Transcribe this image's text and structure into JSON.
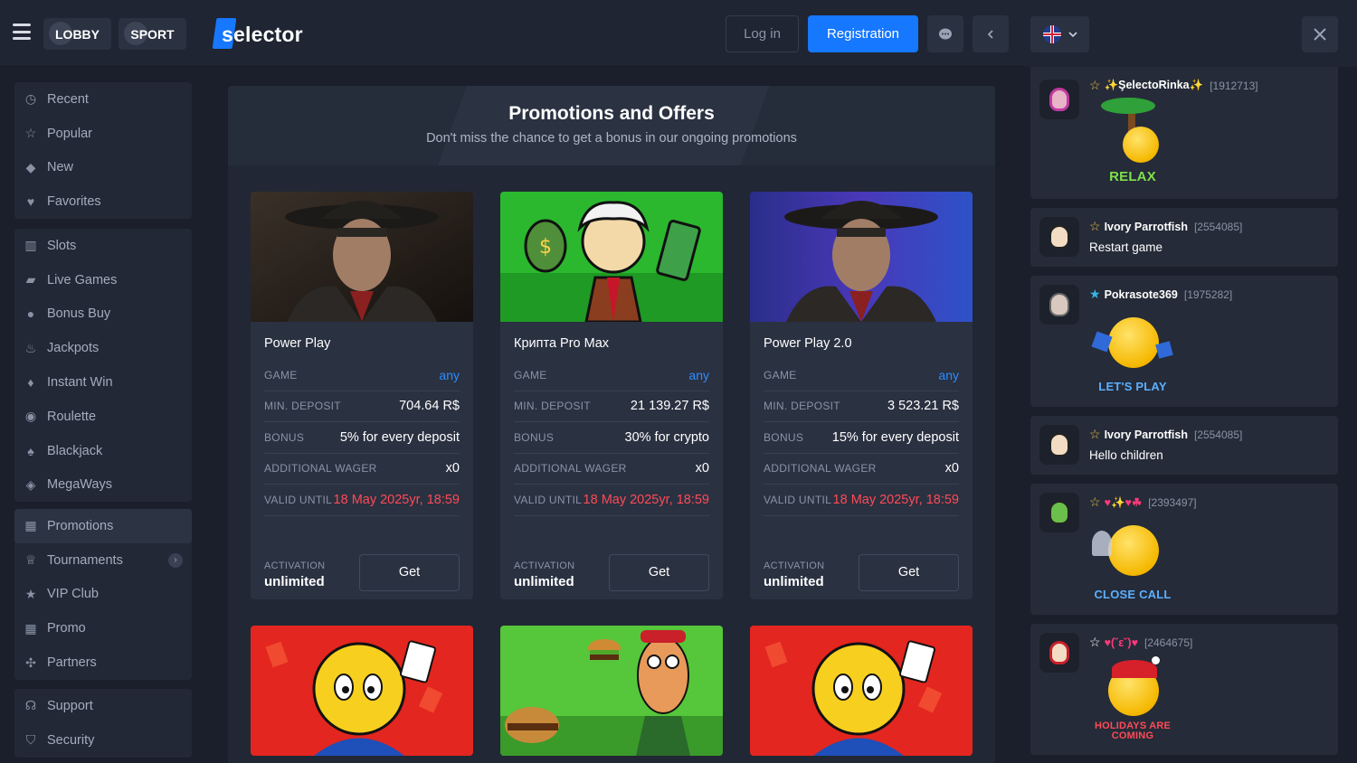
{
  "header": {
    "tabs": [
      {
        "label": "LOBBY"
      },
      {
        "label": "SPORT"
      }
    ],
    "logo": "selector",
    "login_label": "Log in",
    "register_label": "Registration"
  },
  "sidebar": {
    "group1": [
      {
        "label": "Recent",
        "icon": "clock-icon"
      },
      {
        "label": "Popular",
        "icon": "star-icon"
      },
      {
        "label": "New",
        "icon": "diamond-icon"
      },
      {
        "label": "Favorites",
        "icon": "heart-icon"
      }
    ],
    "group2": [
      {
        "label": "Slots",
        "icon": "slots-icon"
      },
      {
        "label": "Live Games",
        "icon": "cards-icon"
      },
      {
        "label": "Bonus Buy",
        "icon": "bonus-icon"
      },
      {
        "label": "Jackpots",
        "icon": "fire-icon"
      },
      {
        "label": "Instant Win",
        "icon": "flame-icon"
      },
      {
        "label": "Roulette",
        "icon": "roulette-icon"
      },
      {
        "label": "Blackjack",
        "icon": "blackjack-icon"
      },
      {
        "label": "MegaWays",
        "icon": "megaways-icon"
      }
    ],
    "group3": [
      {
        "label": "Promotions",
        "icon": "gift-icon"
      },
      {
        "label": "Tournaments",
        "icon": "trophy-icon"
      },
      {
        "label": "VIP Club",
        "icon": "vip-star-icon"
      },
      {
        "label": "Promo",
        "icon": "promo-gift-icon"
      },
      {
        "label": "Partners",
        "icon": "partners-icon"
      }
    ],
    "group4": [
      {
        "label": "Support",
        "icon": "headset-icon"
      },
      {
        "label": "Security",
        "icon": "shield-icon"
      }
    ]
  },
  "promo": {
    "title": "Promotions and Offers",
    "subtitle": "Don't miss the chance to get a bonus in our ongoing promotions",
    "labels": {
      "game": "GAME",
      "min_deposit": "MIN. DEPOSIT",
      "bonus": "BONUS",
      "wager": "ADDITIONAL WAGER",
      "valid": "VALID UNTIL",
      "activation": "ACTIVATION",
      "get": "Get"
    },
    "cards": [
      {
        "title": "Power Play",
        "game": "any",
        "min_deposit": "704.64 R$",
        "bonus": "5% for every deposit",
        "wager": "x0",
        "valid": "18 May 2025yr, 18:59",
        "activation": "unlimited"
      },
      {
        "title": "Крипта Pro Max",
        "game": "any",
        "min_deposit": "21 139.27 R$",
        "bonus": "30% for crypto",
        "wager": "x0",
        "valid": "18 May 2025yr, 18:59",
        "activation": "unlimited"
      },
      {
        "title": "Power Play 2.0",
        "game": "any",
        "min_deposit": "3 523.21 R$",
        "bonus": "15% for every deposit",
        "wager": "x0",
        "valid": "18 May 2025yr, 18:59",
        "activation": "unlimited"
      }
    ]
  },
  "chat": {
    "messages": [
      {
        "name": "✨ŞelectoRinka✨",
        "uid": "[1912713]",
        "sticker": "RELAX"
      },
      {
        "name": "Ivory Parrotfish",
        "uid": "[2554085]",
        "text": "Restart game"
      },
      {
        "name": "Pokrasote369",
        "uid": "[1975282]",
        "sticker": "LET'S PLAY"
      },
      {
        "name": "Ivory Parrotfish",
        "uid": "[2554085]",
        "text": "Hello children"
      },
      {
        "name": "♥✨♥☘",
        "uid": "[2393497]",
        "sticker": "CLOSE CALL"
      },
      {
        "name": "♥(˘ε˘)♥",
        "uid": "[2464675]",
        "sticker": "HOLIDAYS ARE COMING"
      }
    ]
  },
  "colors": {
    "accent": "#1677ff",
    "danger": "#ff4a57",
    "link": "#2d8cff"
  }
}
